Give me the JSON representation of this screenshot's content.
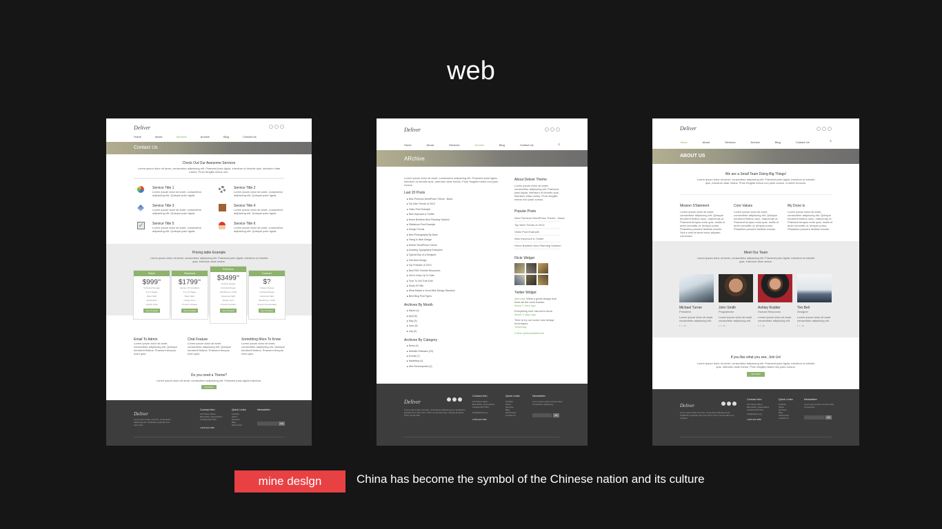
{
  "heading": "web",
  "tag_label": "mine deslgn",
  "caption": "China has become the symbol of the Chinese nation and its culture",
  "colors": {
    "accent_green": "#8db36c",
    "tag_red": "#e84144",
    "footer_dark": "#3d3d3d",
    "background": "#161616"
  },
  "site": {
    "logo": "Deliver",
    "nav": [
      "Home",
      "About",
      "Services",
      "Archive",
      "Blog",
      "Contact Us"
    ],
    "search_icon": "search-icon"
  },
  "contact_page": {
    "banner": "Contact Us",
    "services_title": "Check Out Our Awesome Services",
    "services": [
      {
        "title": "Service Title 1",
        "icon": "pie-chart-icon"
      },
      {
        "title": "Service Title 2",
        "icon": "gear-icon"
      },
      {
        "title": "Service Title 3",
        "icon": "pen-icon"
      },
      {
        "title": "Service Title 4",
        "icon": "box-icon"
      },
      {
        "title": "Service Title 5",
        "icon": "check-icon"
      },
      {
        "title": "Service Title 6",
        "icon": "person-icon"
      }
    ],
    "pricing_title": "Pricing table Example",
    "plans": [
      {
        "name": "Basic",
        "price": "$999",
        "sup": "99",
        "button": "View Detailed"
      },
      {
        "name": "Standard",
        "price": "$1799",
        "sup": "99",
        "button": "View Detailed"
      },
      {
        "name": "Premium",
        "price": "$3499",
        "sup": "99",
        "button": "View Detailed"
      },
      {
        "name": "Custom",
        "price": "$?",
        "sup": "",
        "button": "View Detailed"
      }
    ],
    "cols": [
      "Email To Admin",
      "Chat Feature",
      "Something More To Know"
    ],
    "cta_title": "Do you need a Theme?",
    "cta_button": "Purchase"
  },
  "archive_page": {
    "banner": "ARchive",
    "last_posts_title": "Last 20 Posts",
    "posts": [
      "New Premium WordPress Theme - Basic",
      "Top Web Trends of 2013",
      "Video Post Example",
      "New Improved & Twitter",
      "Home Builders New Planning Solution",
      "Slideshow Post Example",
      "Design Trends",
      "New Photography By Dave",
      "Fixing In Web Design",
      "Deliver WordPress Theme",
      "Amazing Typography Examples",
      "Typical Day of a Designer",
      "Flat Web Design",
      "Top Freebies of 2013",
      "Best PSD Freebie Resources",
      "Get In Keep Up To Date",
      "Time To Get Trott Sure",
      "Shots Of Hills",
      "What Makes a Good Web Design Standout",
      "Best Blog Post Types"
    ],
    "archives_title": "Archives By Month",
    "months": [
      "March (4)",
      "April (5)",
      "May (3)",
      "June (6)",
      "July (2)"
    ],
    "categories_title": "Archives By Category",
    "categories": [
      "News (4)",
      "Website Releases (23)",
      "Events (7)",
      "Marketing (4)",
      "Web Development (2)"
    ],
    "about_title": "About Deliver Theme",
    "popular_title": "Popular Posts",
    "popular": [
      "New Premium WordPress Theme - Basic",
      "Top Web Trends of 2013",
      "Video Post Example",
      "New Improved & Twitter",
      "Home Builders New Planning Solution"
    ],
    "flickr_title": "Flickr Widget",
    "twitter_title": "Twitter Widget",
    "follow": "Follow @templatetheme"
  },
  "about_page": {
    "banner": "ABOUT US",
    "intro_title": "We are a Small Team Doing Big Things!",
    "cols": [
      "Mission STatement",
      "Core Values",
      "My Done Is"
    ],
    "team_title": "Meet Our Team",
    "team": [
      {
        "name": "Michael Turner",
        "role": "President"
      },
      {
        "name": "John Smith",
        "role": "Programmer"
      },
      {
        "name": "Ashley Rudder",
        "role": "Human Resources"
      },
      {
        "name": "Tim Bell",
        "role": "Designer"
      }
    ],
    "cta_title": "If you like what you see, Join Us!",
    "cta_button": "Join Team"
  },
  "footer": {
    "contact_title": "Contact Info",
    "links_title": "Quick Links",
    "newsletter_title": "Newsletter",
    "links": [
      "Portfolio",
      "About",
      "Services",
      "Blog",
      "Shortcodes",
      "Contact Us"
    ],
    "phone": "1.800.222.3456",
    "ok": "OK"
  }
}
